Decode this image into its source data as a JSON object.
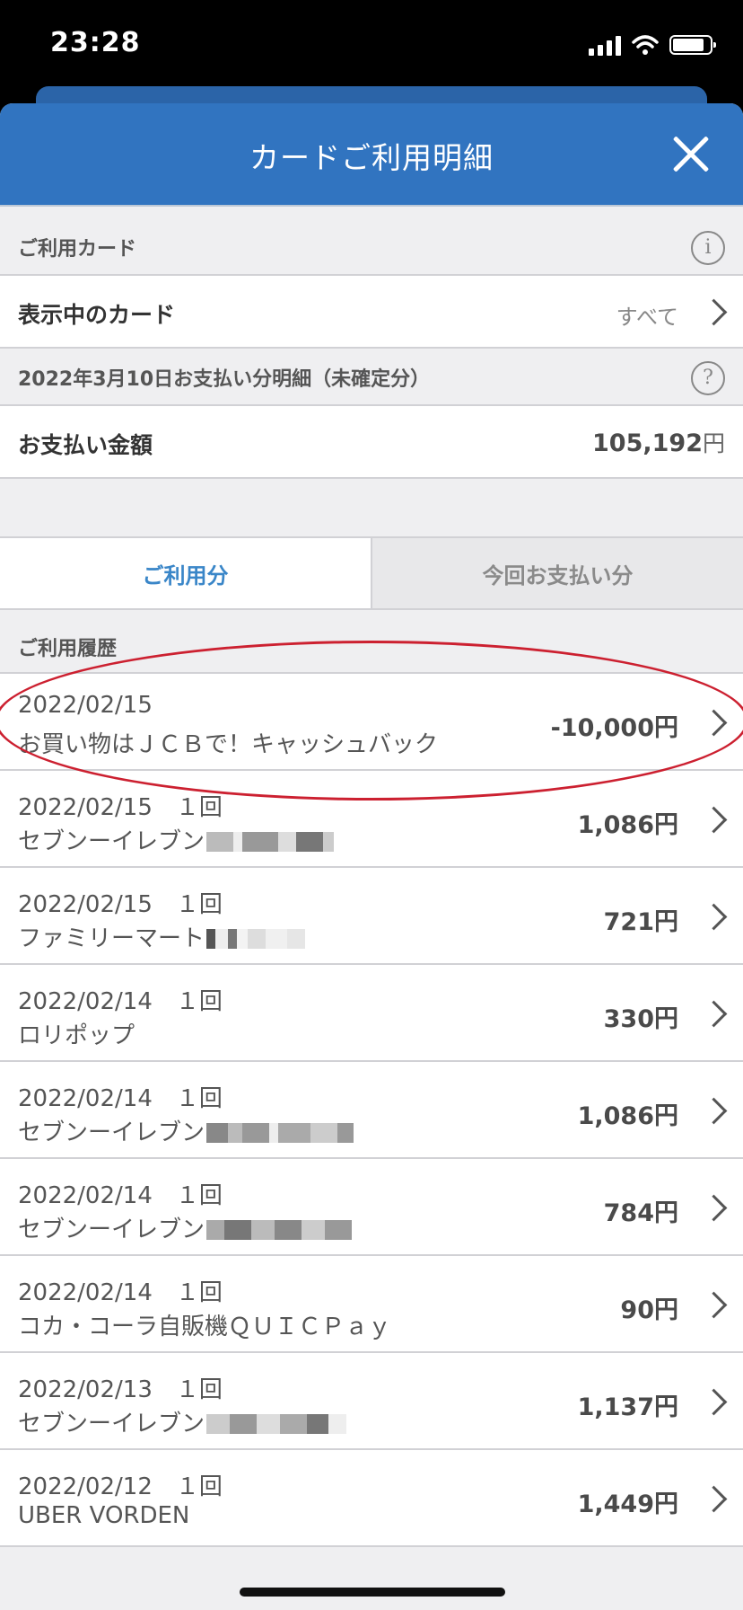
{
  "status": {
    "time": "23:28"
  },
  "header": {
    "title": "カードご利用明細"
  },
  "card_section": {
    "label": "ご利用カード",
    "info_icon": "info-icon"
  },
  "card_row": {
    "label": "表示中のカード",
    "value": "すべて"
  },
  "payment_section": {
    "label": "2022年3月10日お支払い分明細（未確定分）",
    "help_icon": "help-icon"
  },
  "payment_row": {
    "label": "お支払い金額",
    "amount": "105,192",
    "unit": "円"
  },
  "tabs": [
    {
      "label": "ご利用分",
      "active": true
    },
    {
      "label": "今回お支払い分",
      "active": false
    }
  ],
  "history": {
    "label": "ご利用履歴",
    "items": [
      {
        "date": "2022/02/15",
        "name": "お買い物はＪＣＢで！キャッシュバック",
        "amount": "-10,000円",
        "highlighted": true
      },
      {
        "date": "2022/02/15　１回",
        "name": "セブンーイレブン",
        "amount": "1,086円",
        "redacted": true
      },
      {
        "date": "2022/02/15　１回",
        "name": "ファミリーマート",
        "amount": "721円",
        "redacted": true
      },
      {
        "date": "2022/02/14　１回",
        "name": "ロリポップ",
        "amount": "330円"
      },
      {
        "date": "2022/02/14　１回",
        "name": "セブンーイレブン",
        "amount": "1,086円",
        "redacted": true
      },
      {
        "date": "2022/02/14　１回",
        "name": "セブンーイレブン",
        "amount": "784円",
        "redacted": true
      },
      {
        "date": "2022/02/14　１回",
        "name": "コカ・コーラ自販機ＱＵＩＣＰａｙ",
        "amount": "90円"
      },
      {
        "date": "2022/02/13　１回",
        "name": "セブンーイレブン",
        "amount": "1,137円",
        "redacted": true
      },
      {
        "date": "2022/02/12　１回",
        "name": "UBER VORDEN",
        "amount": "1,449円"
      }
    ]
  },
  "colors": {
    "header_blue": "#3174c0",
    "tab_active": "#3a86c8",
    "highlight_red": "#cc2030"
  }
}
